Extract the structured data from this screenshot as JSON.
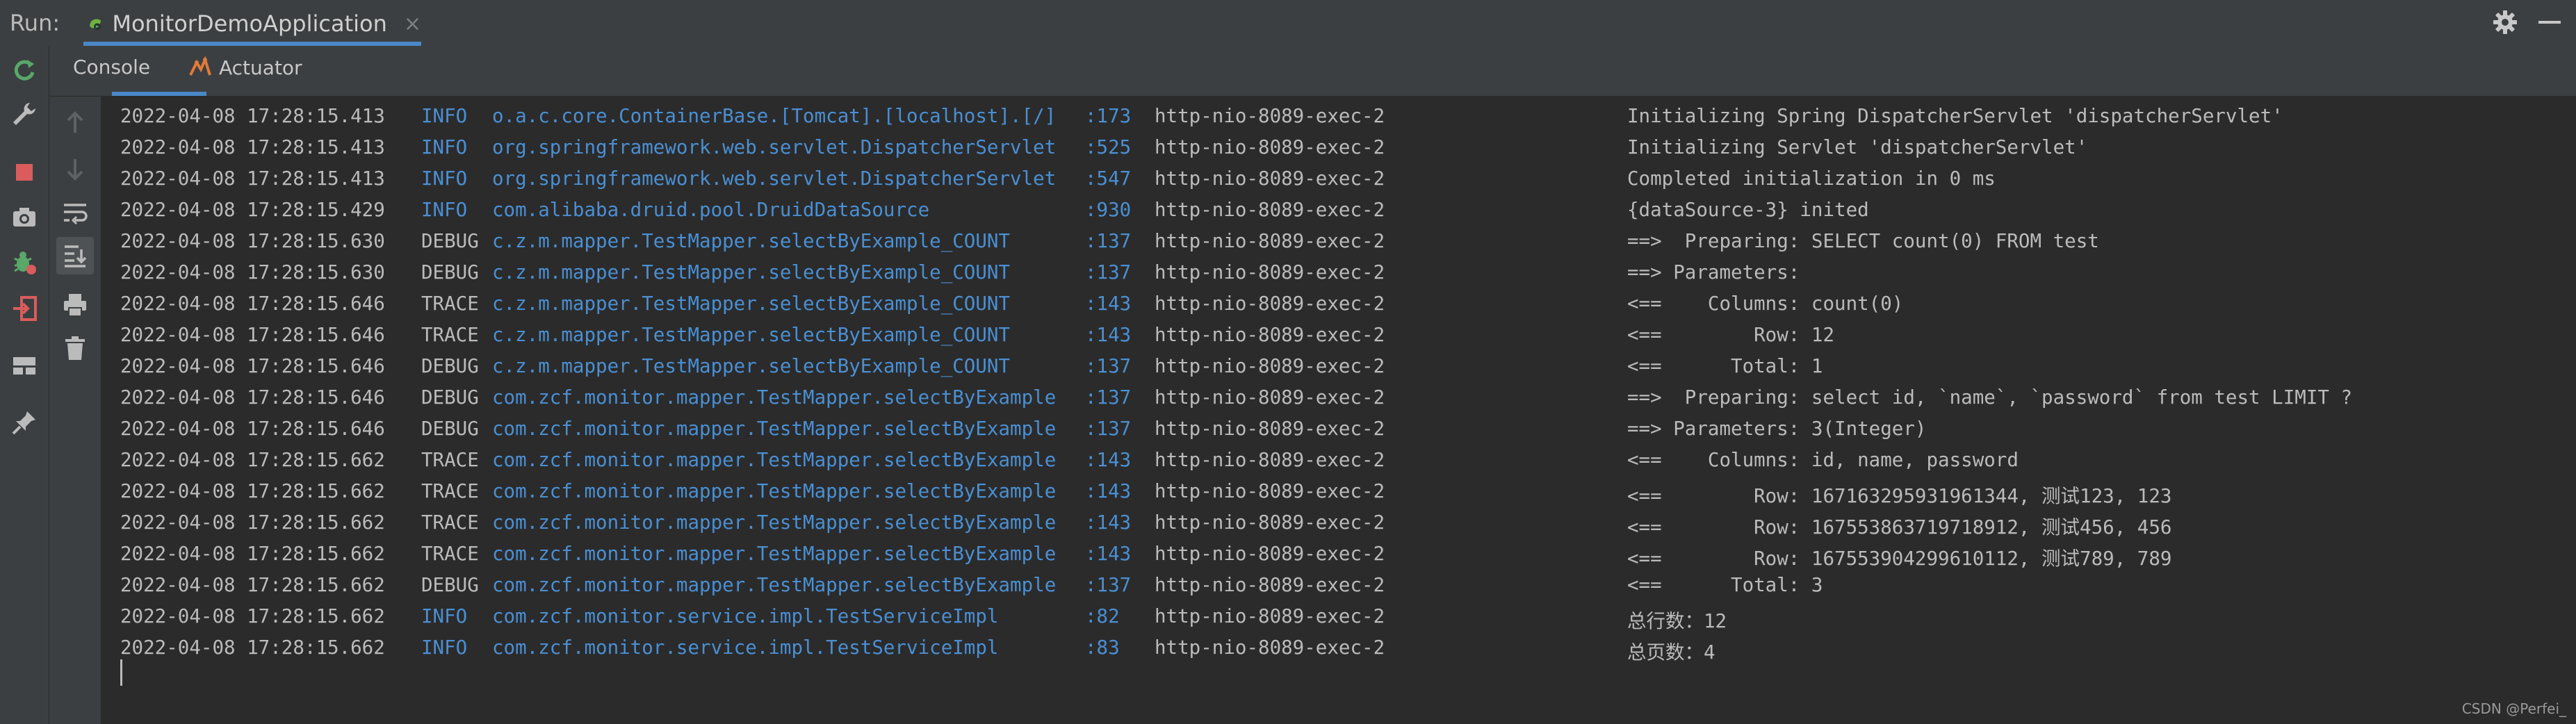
{
  "run_bar": {
    "label": "Run:",
    "tab_title": "MonitorDemoApplication",
    "close_glyph": "×",
    "icons": [
      "spring-boot-run-icon",
      "gear-icon",
      "minimize-icon"
    ]
  },
  "subtabs": [
    {
      "label": "Console",
      "icon": "none",
      "selected": true
    },
    {
      "label": "Actuator",
      "icon": "actuator-icon",
      "selected": false
    }
  ],
  "left_toolbar_icons": [
    "rerun-icon",
    "wrench-icon",
    "stop-icon",
    "camera-icon",
    "debug-icon",
    "exit-icon",
    "layout-icon",
    "pin-icon"
  ],
  "console_toolbar_icons": [
    "up-arrow-icon",
    "down-arrow-icon",
    "soft-wrap-icon",
    "scroll-to-end-icon",
    "print-icon",
    "trash-icon"
  ],
  "colors": {
    "accent": "#4a88c7",
    "info": "#4a8fd3",
    "logger": "#4a8fd3",
    "text": "#bbbbbb",
    "background": "#2b2b2b",
    "stop": "#db5c5c",
    "rerun": "#59a869"
  },
  "log_lines": [
    {
      "ts": "2022-04-08 17:28:15.413",
      "level": "INFO",
      "logger": "o.a.c.core.ContainerBase.[Tomcat].[localhost].[/]",
      "line": ":173",
      "thread": "http-nio-8089-exec-2",
      "msg": "Initializing Spring DispatcherServlet 'dispatcherServlet'"
    },
    {
      "ts": "2022-04-08 17:28:15.413",
      "level": "INFO",
      "logger": "org.springframework.web.servlet.DispatcherServlet",
      "line": ":525",
      "thread": "http-nio-8089-exec-2",
      "msg": "Initializing Servlet 'dispatcherServlet'"
    },
    {
      "ts": "2022-04-08 17:28:15.413",
      "level": "INFO",
      "logger": "org.springframework.web.servlet.DispatcherServlet",
      "line": ":547",
      "thread": "http-nio-8089-exec-2",
      "msg": "Completed initialization in 0 ms"
    },
    {
      "ts": "2022-04-08 17:28:15.429",
      "level": "INFO",
      "logger": "com.alibaba.druid.pool.DruidDataSource",
      "line": ":930",
      "thread": "http-nio-8089-exec-2",
      "msg": "{dataSource-3} inited"
    },
    {
      "ts": "2022-04-08 17:28:15.630",
      "level": "DEBUG",
      "logger": "c.z.m.mapper.TestMapper.selectByExample_COUNT",
      "line": ":137",
      "thread": "http-nio-8089-exec-2",
      "msg": "==>  Preparing: SELECT count(0) FROM test"
    },
    {
      "ts": "2022-04-08 17:28:15.630",
      "level": "DEBUG",
      "logger": "c.z.m.mapper.TestMapper.selectByExample_COUNT",
      "line": ":137",
      "thread": "http-nio-8089-exec-2",
      "msg": "==> Parameters: "
    },
    {
      "ts": "2022-04-08 17:28:15.646",
      "level": "TRACE",
      "logger": "c.z.m.mapper.TestMapper.selectByExample_COUNT",
      "line": ":143",
      "thread": "http-nio-8089-exec-2",
      "msg": "<==    Columns: count(0)"
    },
    {
      "ts": "2022-04-08 17:28:15.646",
      "level": "TRACE",
      "logger": "c.z.m.mapper.TestMapper.selectByExample_COUNT",
      "line": ":143",
      "thread": "http-nio-8089-exec-2",
      "msg": "<==        Row: 12"
    },
    {
      "ts": "2022-04-08 17:28:15.646",
      "level": "DEBUG",
      "logger": "c.z.m.mapper.TestMapper.selectByExample_COUNT",
      "line": ":137",
      "thread": "http-nio-8089-exec-2",
      "msg": "<==      Total: 1"
    },
    {
      "ts": "2022-04-08 17:28:15.646",
      "level": "DEBUG",
      "logger": "com.zcf.monitor.mapper.TestMapper.selectByExample",
      "line": ":137",
      "thread": "http-nio-8089-exec-2",
      "msg": "==>  Preparing: select id, `name`, `password` from test LIMIT ?"
    },
    {
      "ts": "2022-04-08 17:28:15.646",
      "level": "DEBUG",
      "logger": "com.zcf.monitor.mapper.TestMapper.selectByExample",
      "line": ":137",
      "thread": "http-nio-8089-exec-2",
      "msg": "==> Parameters: 3(Integer)"
    },
    {
      "ts": "2022-04-08 17:28:15.662",
      "level": "TRACE",
      "logger": "com.zcf.monitor.mapper.TestMapper.selectByExample",
      "line": ":143",
      "thread": "http-nio-8089-exec-2",
      "msg": "<==    Columns: id, name, password"
    },
    {
      "ts": "2022-04-08 17:28:15.662",
      "level": "TRACE",
      "logger": "com.zcf.monitor.mapper.TestMapper.selectByExample",
      "line": ":143",
      "thread": "http-nio-8089-exec-2",
      "msg": "<==        Row: 167163295931961344, 测试123, 123"
    },
    {
      "ts": "2022-04-08 17:28:15.662",
      "level": "TRACE",
      "logger": "com.zcf.monitor.mapper.TestMapper.selectByExample",
      "line": ":143",
      "thread": "http-nio-8089-exec-2",
      "msg": "<==        Row: 167553863719718912, 测试456, 456"
    },
    {
      "ts": "2022-04-08 17:28:15.662",
      "level": "TRACE",
      "logger": "com.zcf.monitor.mapper.TestMapper.selectByExample",
      "line": ":143",
      "thread": "http-nio-8089-exec-2",
      "msg": "<==        Row: 167553904299610112, 测试789, 789"
    },
    {
      "ts": "2022-04-08 17:28:15.662",
      "level": "DEBUG",
      "logger": "com.zcf.monitor.mapper.TestMapper.selectByExample",
      "line": ":137",
      "thread": "http-nio-8089-exec-2",
      "msg": "<==      Total: 3"
    },
    {
      "ts": "2022-04-08 17:28:15.662",
      "level": "INFO",
      "logger": "com.zcf.monitor.service.impl.TestServiceImpl",
      "line": ":82",
      "thread": "http-nio-8089-exec-2",
      "msg": "总行数：12"
    },
    {
      "ts": "2022-04-08 17:28:15.662",
      "level": "INFO",
      "logger": "com.zcf.monitor.service.impl.TestServiceImpl",
      "line": ":83",
      "thread": "http-nio-8089-exec-2",
      "msg": "总页数：4"
    }
  ],
  "watermark": "CSDN @Perfei_"
}
